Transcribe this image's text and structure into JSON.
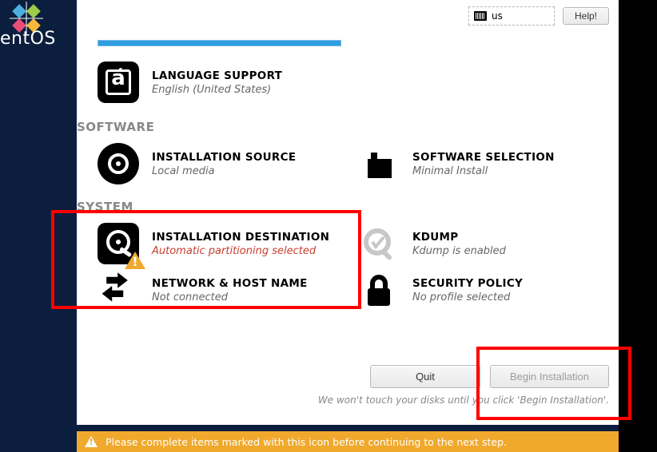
{
  "brand": {
    "name": "entOS"
  },
  "topbar": {
    "keyboard_layout": "us",
    "help_label": "Help!"
  },
  "sections": {
    "localization": {
      "language_support": {
        "title": "LANGUAGE SUPPORT",
        "sub": "English (United States)"
      }
    },
    "software": {
      "header": "SOFTWARE",
      "installation_source": {
        "title": "INSTALLATION SOURCE",
        "sub": "Local media"
      },
      "software_selection": {
        "title": "SOFTWARE SELECTION",
        "sub": "Minimal Install"
      }
    },
    "system": {
      "header": "SYSTEM",
      "installation_destination": {
        "title": "INSTALLATION DESTINATION",
        "sub": "Automatic partitioning selected"
      },
      "kdump": {
        "title": "KDUMP",
        "sub": "Kdump is enabled"
      },
      "network": {
        "title": "NETWORK & HOST NAME",
        "sub": "Not connected"
      },
      "security_policy": {
        "title": "SECURITY POLICY",
        "sub": "No profile selected"
      }
    }
  },
  "footer": {
    "quit_label": "Quit",
    "begin_label": "Begin Installation",
    "note": "We won't touch your disks until you click 'Begin Installation'."
  },
  "warning_bar": "Please complete items marked with this icon before continuing to the next step."
}
